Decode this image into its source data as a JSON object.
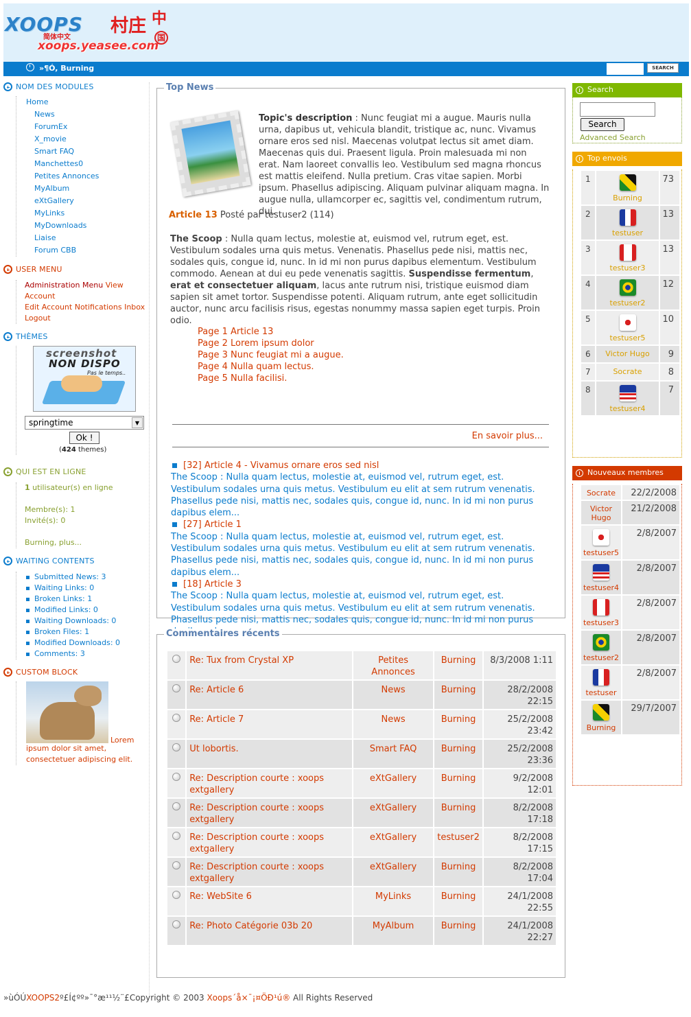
{
  "header": {
    "logo_text": "XOOPS",
    "logo_cn_main": "村庄",
    "logo_cn_side": "中",
    "logo_cn_ring": "国",
    "logo_subtext": "简体中文",
    "logo_url": "xoops.yeasee.com",
    "nav_user": "»¶Ó, Burning",
    "search_button": "SEARCH"
  },
  "left": {
    "modules_title": "NOM DES MODULES",
    "modules": [
      "Home",
      "News",
      "ForumEx",
      "X_movie",
      "Smart FAQ",
      "Manchettes0",
      "Petites Annonces",
      "MyAlbum",
      "eXtGallery",
      "MyLinks",
      "MyDownloads",
      "Liaise",
      "Forum CBB"
    ],
    "usermenu_title": "USER MENU",
    "usermenu": [
      "Administration Menu",
      "View Account",
      "Edit Account",
      "Notifications",
      "Inbox",
      "Logout"
    ],
    "themes_title": "THÈMES",
    "theme_img_line1": "screenshot",
    "theme_img_line2": "NON DISPO",
    "theme_img_line3": "Pas le temps..",
    "theme_selected": "springtime",
    "theme_ok": "Ok !",
    "theme_count": "424",
    "theme_count_suffix": " themes)",
    "theme_count_prefix": "(",
    "online_title": "QUI EST EN LIGNE",
    "online_count": "1",
    "online_line1": " utilisateur(s) en ligne",
    "online_members": "Membre(s): 1",
    "online_guests": "Invité(s): 0",
    "online_more": "Burning, plus...",
    "waiting_title": "WAITING CONTENTS",
    "waiting": [
      "Submitted News: 3",
      "Waiting Links: 0",
      "Broken Links: 1",
      "Modified Links: 0",
      "Waiting Downloads: 0",
      "Broken Files: 1",
      "Modified Downloads: 0",
      "Comments: 3"
    ],
    "custom_title": "CUSTOM BLOCK",
    "custom_text": "Lorem ipsum dolor sit amet, consectetuer adipiscing elit."
  },
  "topnews": {
    "legend": "Top News",
    "desc_label": "Topic's description",
    "desc_text": " : Nunc feugiat mi a augue. Mauris nulla urna, dapibus ut, vehicula blandit, tristique ac, nunc. Vivamus ornare eros sed nisl. Maecenas volutpat lectus sit amet diam. Maecenas quis dui. Praesent ligula. Proin malesuada mi non erat. Nam laoreet convallis leo. Vestibulum sed magna rhoncus est mattis eleifend. Nulla pretium. Cras vitae sapien. Morbi ipsum. Phasellus adipiscing. Aliquam pulvinar aliquam magna. In augue nulla, ullamcorper ec, sagittis vel, condimentum rutrum, dui.",
    "article_link": "Article 13",
    "article_meta": " Posté par testuser2 (114)",
    "scoop_label": "The Scoop",
    "scoop_text1": " : Nulla quam lectus, molestie at, euismod vel, rutrum eget, est. Vestibulum sodales urna quis metus. Venenatis. Phasellus pede nisi, mattis nec, sodales quis, congue id, nunc. In id mi non purus dapibus elementum. Vestibulum commodo. Aenean at dui eu pede venenatis sagittis. ",
    "scoop_bold": "Suspendisse fermentum",
    "scoop_mid": ", ",
    "scoop_bold2": "erat et consectetuer aliquam",
    "scoop_text2": ", lacus ante rutrum nisi, tristique euismod diam sapien sit amet tortor. Suspendisse potenti. Aliquam rutrum, ante eget sollicitudin auctor, nunc arcu facilisis risus, egestas nonummy massa sapien eget turpis. Proin odio.",
    "pages": [
      "Page 1 Article 13",
      "Page 2 Lorem ipsum dolor",
      "Page 3 Nunc feugiat mi a augue.",
      "Page 4 Nulla quam lectus.",
      "Page 5 Nulla facilisi."
    ],
    "more": "En savoir plus...",
    "news": [
      {
        "title": "[32] Article 4 - Vivamus ornare eros sed nisl",
        "text": "The Scoop : Nulla quam lectus, molestie at, euismod vel, rutrum eget, est. Vestibulum sodales urna quis metus. Vestibulum eu elit at sem rutrum venenatis. Phasellus pede nisi, mattis nec, sodales quis, congue id, nunc. In id mi non purus dapibus elem..."
      },
      {
        "title": "[27] Article 1",
        "text": "The Scoop : Nulla quam lectus, molestie at, euismod vel, rutrum eget, est. Vestibulum sodales urna quis metus. Vestibulum eu elit at sem rutrum venenatis. Phasellus pede nisi, mattis nec, sodales quis, congue id, nunc. In id mi non purus dapibus elem..."
      },
      {
        "title": "[18] Article 3",
        "text": "The Scoop : Nulla quam lectus, molestie at, euismod vel, rutrum eget, est. Vestibulum sodales urna quis metus. Vestibulum eu elit at sem rutrum venenatis. Phasellus pede nisi, mattis nec, sodales quis, congue id, nunc. In id mi non purus dapibus elem..."
      }
    ]
  },
  "comments": {
    "legend": "Commentaires récents",
    "rows": [
      {
        "title": "Re: Tux from Crystal XP",
        "module": "Petites Annonces",
        "user": "Burning",
        "date": "8/3/2008 1:11"
      },
      {
        "title": "Re: Article 6",
        "module": "News",
        "user": "Burning",
        "date": "28/2/2008 22:15"
      },
      {
        "title": "Re: Article 7",
        "module": "News",
        "user": "Burning",
        "date": "25/2/2008 23:42"
      },
      {
        "title": "Ut lobortis.",
        "module": "Smart FAQ",
        "user": "Burning",
        "date": "25/2/2008 23:36"
      },
      {
        "title": "Re: Description courte : xoops extgallery",
        "module": "eXtGallery",
        "user": "Burning",
        "date": "9/2/2008 12:01"
      },
      {
        "title": "Re: Description courte : xoops extgallery",
        "module": "eXtGallery",
        "user": "Burning",
        "date": "8/2/2008 17:18"
      },
      {
        "title": "Re: Description courte : xoops extgallery",
        "module": "eXtGallery",
        "user": "testuser2",
        "date": "8/2/2008 17:15"
      },
      {
        "title": "Re: Description courte : xoops extgallery",
        "module": "eXtGallery",
        "user": "Burning",
        "date": "8/2/2008 17:04"
      },
      {
        "title": "Re: WebSite 6",
        "module": "MyLinks",
        "user": "Burning",
        "date": "24/1/2008 22:55"
      },
      {
        "title": "Re: Photo Catégorie 03b 20",
        "module": "MyAlbum",
        "user": "Burning",
        "date": "24/1/2008 22:27"
      }
    ]
  },
  "right": {
    "search_title": "Search",
    "search_button": "Search",
    "advanced": "Advanced Search",
    "top_title": "Top envois",
    "top": [
      {
        "rank": "1",
        "name": "Burning",
        "count": "73",
        "flag": "f-jam"
      },
      {
        "rank": "2",
        "name": "testuser",
        "count": "13",
        "flag": "f-fra"
      },
      {
        "rank": "3",
        "name": "testuser3",
        "count": "13",
        "flag": "f-can"
      },
      {
        "rank": "4",
        "name": "testuser2",
        "count": "12",
        "flag": "f-bra"
      },
      {
        "rank": "5",
        "name": "testuser5",
        "count": "10",
        "flag": "f-kor"
      },
      {
        "rank": "6",
        "name": "Victor Hugo",
        "count": "9",
        "flag": ""
      },
      {
        "rank": "7",
        "name": "Socrate",
        "count": "8",
        "flag": ""
      },
      {
        "rank": "8",
        "name": "testuser4",
        "count": "7",
        "flag": "f-usa"
      }
    ],
    "new_title": "Nouveaux membres",
    "new": [
      {
        "name": "Socrate",
        "date": "22/2/2008",
        "flag": ""
      },
      {
        "name": "Victor Hugo",
        "date": "21/2/2008",
        "flag": ""
      },
      {
        "name": "testuser5",
        "date": "2/8/2007",
        "flag": "f-kor"
      },
      {
        "name": "testuser4",
        "date": "2/8/2007",
        "flag": "f-usa"
      },
      {
        "name": "testuser3",
        "date": "2/8/2007",
        "flag": "f-can"
      },
      {
        "name": "testuser2",
        "date": "2/8/2007",
        "flag": "f-bra"
      },
      {
        "name": "testuser",
        "date": "2/8/2007",
        "flag": "f-fra"
      },
      {
        "name": "Burning",
        "date": "29/7/2007",
        "flag": "f-jam"
      }
    ]
  },
  "footer": {
    "pre": "»ùÓÚ",
    "xoops2": "XOOPS2",
    "mid": "º£Í¢ºº»¯°æ¹¹½¨£Copyright © 2003 ",
    "xoops": "Xoops",
    "cn": "´å×¯¡¤ÖÐ¹ú®",
    "post": " All Rights Reserved"
  },
  "colors": {
    "accent": "#0b7ccd",
    "link": "#d33a00",
    "olive": "#88a030",
    "gold": "#f0a800",
    "green_title": "#7fb800",
    "red_title": "#d33a00"
  }
}
